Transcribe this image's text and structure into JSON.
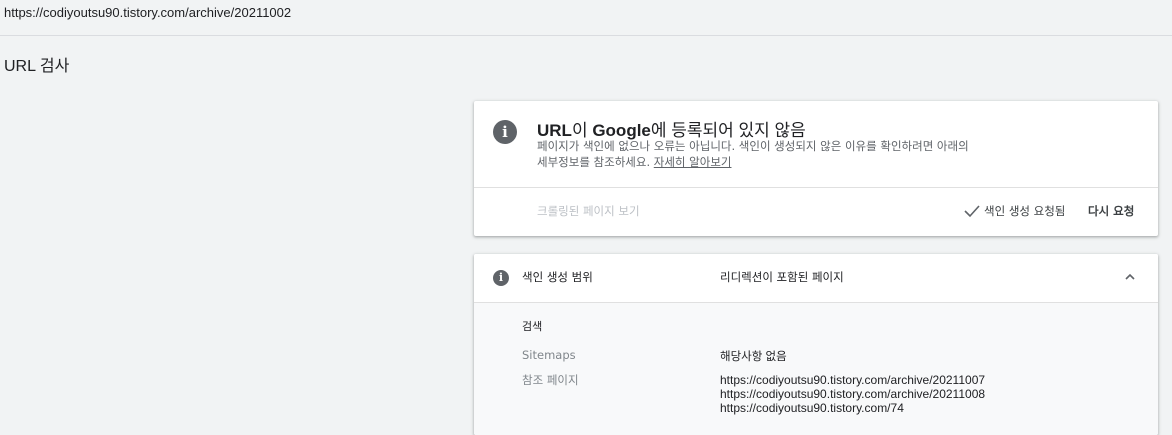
{
  "address_bar": {
    "url": "https://codiyoutsu90.tistory.com/archive/20211002"
  },
  "page": {
    "title": "URL 검사"
  },
  "status_card": {
    "title_prefix": "URL",
    "title_mid": "이 ",
    "title_brand": "Google",
    "title_suffix": "에 등록되어 있지 않음",
    "description": "페이지가 색인에 없으나 오류는 아닙니다. 색인이 생성되지 않은 이유를 확인하려면 아래의 세부정보를 참조하세요. ",
    "learn_more": "자세히 알아보기",
    "crawled_page_button": "크롤링된 페이지 보기",
    "indexing_requested": "색인 생성 요청됨",
    "request_again_button": "다시 요청",
    "info_icon": "i"
  },
  "coverage": {
    "label": "색인 생성 범위",
    "value": "리디렉션이 포함된 페이지",
    "section_heading": "검색",
    "sitemaps_label": "Sitemaps",
    "sitemaps_value": "해당사항 없음",
    "referring_label": "참조 페이지",
    "referring_pages": [
      "https://codiyoutsu90.tistory.com/archive/20211007",
      "https://codiyoutsu90.tistory.com/archive/20211008",
      "https://codiyoutsu90.tistory.com/74"
    ],
    "info_icon": "i"
  },
  "colors": {
    "icon_gray": "#5f6368",
    "background": "#f1f3f4",
    "card": "#ffffff"
  }
}
